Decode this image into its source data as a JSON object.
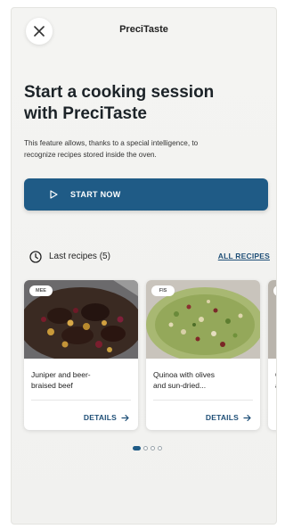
{
  "header": {
    "title": "PreciTaste",
    "close_icon": "close-icon"
  },
  "hero": {
    "title_line1": "Start a cooking session",
    "title_line2": "with PreciTaste",
    "description_line1": "This feature allows, thanks to a special intelligence, to",
    "description_line2": "recognize recipes stored inside the oven."
  },
  "start_button": {
    "label": "START NOW",
    "icon": "play-icon"
  },
  "last_recipes": {
    "label": "Last recipes (5)",
    "icon": "clock-icon",
    "all_link": "ALL RECIPES"
  },
  "recipes": [
    {
      "badge": "MEE",
      "name_line1": "Juniper and beer-",
      "name_line2": "braised beef",
      "details": "DETAILS"
    },
    {
      "badge": "FIS",
      "name_line1": "Quinoa with olives",
      "name_line2": "and sun-dried...",
      "details": "DETAILS"
    },
    {
      "badge": "",
      "name_line1": "Qu",
      "name_line2": "an",
      "details": ""
    }
  ],
  "pagination": {
    "pages": 4,
    "active": 0
  },
  "colors": {
    "primary": "#1f5b86",
    "link": "#1f4f77",
    "background": "#f3f3f1"
  }
}
